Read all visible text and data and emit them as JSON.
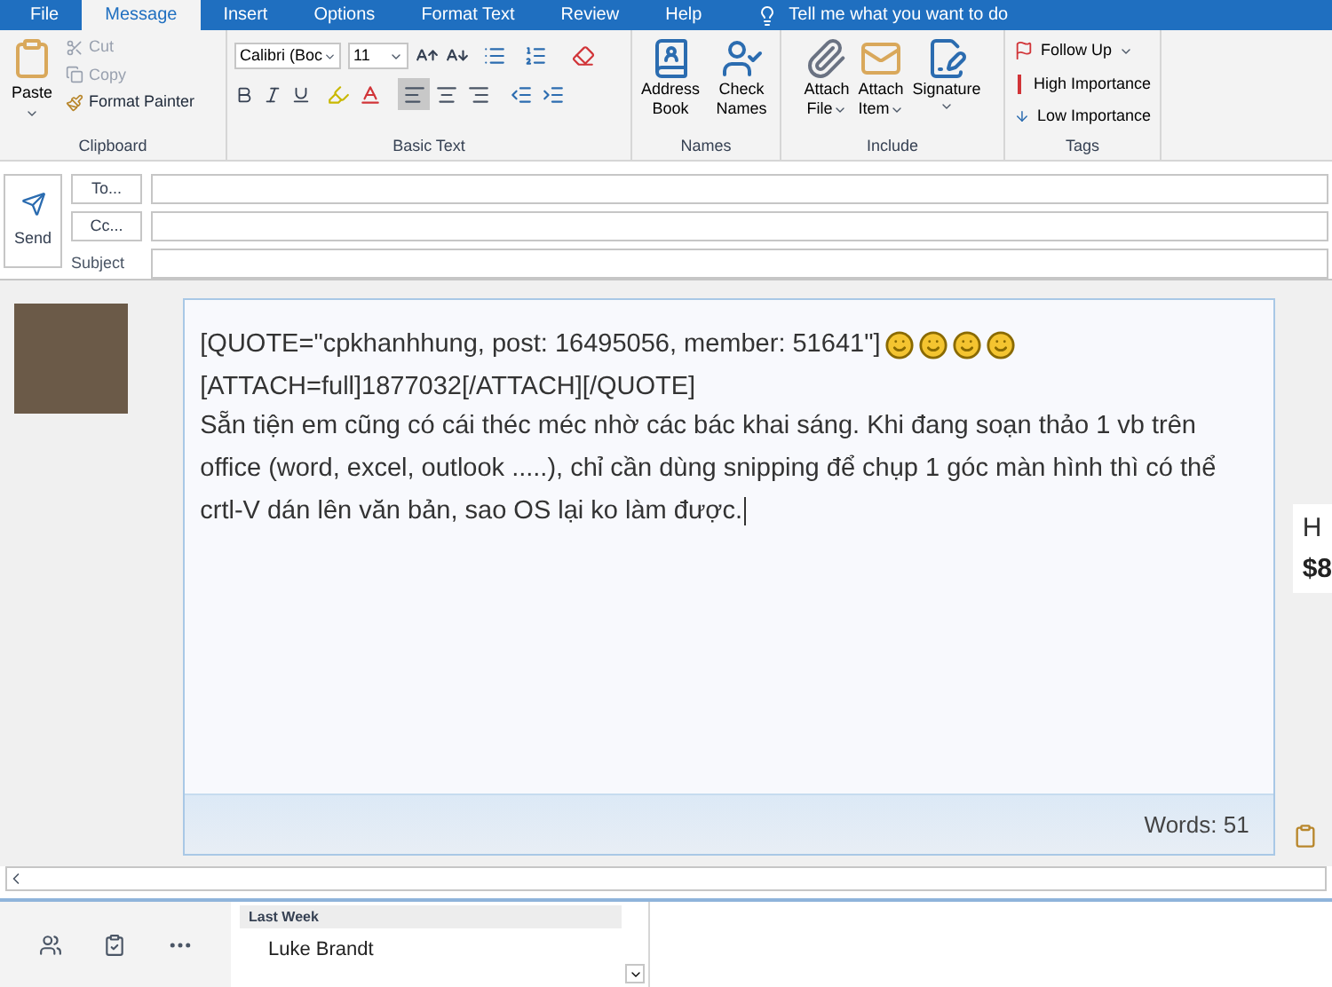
{
  "tabs": [
    {
      "label": "File",
      "selected": false
    },
    {
      "label": "Message",
      "selected": true
    },
    {
      "label": "Insert",
      "selected": false
    },
    {
      "label": "Options",
      "selected": false
    },
    {
      "label": "Format Text",
      "selected": false
    },
    {
      "label": "Review",
      "selected": false
    },
    {
      "label": "Help",
      "selected": false
    }
  ],
  "tell_me": {
    "placeholder": "Tell me what you want to do"
  },
  "clipboard": {
    "label": "Clipboard",
    "paste": "Paste",
    "cut": {
      "label": "Cut",
      "disabled": true
    },
    "copy": {
      "label": "Copy",
      "disabled": true
    },
    "format_painter": "Format Painter"
  },
  "basic_text": {
    "label": "Basic Text",
    "font": "Calibri (Boc",
    "size": "11",
    "alignment": [
      {
        "kind": "left",
        "selected": true
      },
      {
        "kind": "center",
        "selected": false
      },
      {
        "kind": "right",
        "selected": false
      }
    ]
  },
  "names": {
    "label": "Names",
    "buttons": [
      {
        "kind": "address-book",
        "label": "Address Book"
      },
      {
        "kind": "check-names",
        "label": "Check Names"
      }
    ]
  },
  "include": {
    "label": "Include",
    "buttons": [
      {
        "kind": "attach-file",
        "top": "Attach",
        "bottom": "File"
      },
      {
        "kind": "attach-item",
        "top": "Attach",
        "bottom": "Item"
      },
      {
        "kind": "signature",
        "top": "Signature"
      }
    ]
  },
  "tags": {
    "label": "Tags",
    "items": [
      {
        "kind": "follow-up",
        "label": "Follow Up"
      },
      {
        "kind": "high",
        "label": "High Importance"
      },
      {
        "kind": "low",
        "label": "Low Importance"
      }
    ]
  },
  "header": {
    "send": "Send",
    "to": "To...",
    "cc": "Cc...",
    "subject": "Subject"
  },
  "editor": {
    "lines": [
      "[QUOTE=\"cpkhanhhung, post: 16495056, member: 51641\"]",
      "[ATTACH=full]1877032[/ATTACH][/QUOTE]"
    ],
    "smileys": [
      {
        "kind": "smiley"
      },
      {
        "kind": "smiley"
      },
      {
        "kind": "smiley"
      },
      {
        "kind": "smiley"
      }
    ],
    "paragraph": "Sẵn tiện em cũng có cái théc méc nhờ các bác khai sáng. Khi đang soạn thảo 1 vb trên office (word, excel, outlook .....), chỉ cần dùng snipping để chụp 1 góc màn hình thì có thể crtl-V dán lên văn bản, sao OS lại ko làm được.",
    "words": "Words: 51"
  },
  "side_card": {
    "line_1": "H",
    "line_2": "$8"
  },
  "mail_list": {
    "group": "Last Week",
    "sender": "Luke Brandt"
  }
}
